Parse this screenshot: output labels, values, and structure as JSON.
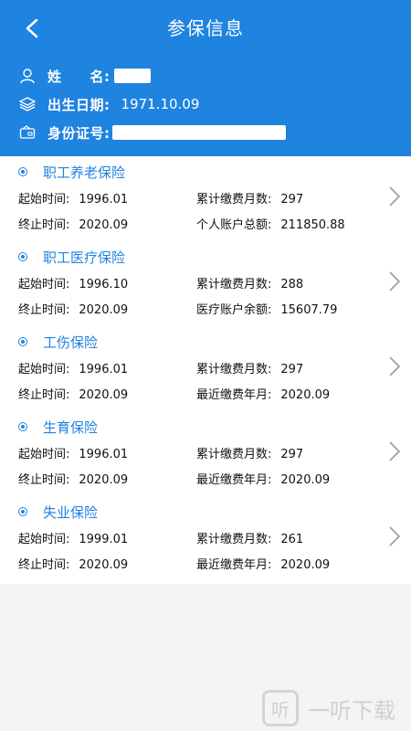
{
  "header": {
    "title": "参保信息",
    "name_label": "姓　　名:",
    "birth_label": "出生日期:",
    "birth_value": "1971.10.09",
    "id_label": "身份证号:"
  },
  "sections": [
    {
      "title": "职工养老保险",
      "start_label": "起始时间:",
      "start_value": "1996.01",
      "months_label": "累计缴费月数:",
      "months_value": "297",
      "end_label": "终止时间:",
      "end_value": "2020.09",
      "extra_label": "个人账户总额:",
      "extra_value": "211850.88"
    },
    {
      "title": "职工医疗保险",
      "start_label": "起始时间:",
      "start_value": "1996.10",
      "months_label": "累计缴费月数:",
      "months_value": "288",
      "end_label": "终止时间:",
      "end_value": "2020.09",
      "extra_label": "医疗账户余额:",
      "extra_value": "15607.79"
    },
    {
      "title": "工伤保险",
      "start_label": "起始时间:",
      "start_value": "1996.01",
      "months_label": "累计缴费月数:",
      "months_value": "297",
      "end_label": "终止时间:",
      "end_value": "2020.09",
      "extra_label": "最近缴费年月:",
      "extra_value": "2020.09"
    },
    {
      "title": "生育保险",
      "start_label": "起始时间:",
      "start_value": "1996.01",
      "months_label": "累计缴费月数:",
      "months_value": "297",
      "end_label": "终止时间:",
      "end_value": "2020.09",
      "extra_label": "最近缴费年月:",
      "extra_value": "2020.09"
    },
    {
      "title": "失业保险",
      "start_label": "起始时间:",
      "start_value": "1999.01",
      "months_label": "累计缴费月数:",
      "months_value": "261",
      "end_label": "终止时间:",
      "end_value": "2020.09",
      "extra_label": "最近缴费年月:",
      "extra_value": "2020.09"
    }
  ],
  "watermark": {
    "text": "一听下载",
    "logo_char": "听"
  },
  "colors": {
    "header_bg": "#1f83e0",
    "accent": "#1f83e0"
  }
}
